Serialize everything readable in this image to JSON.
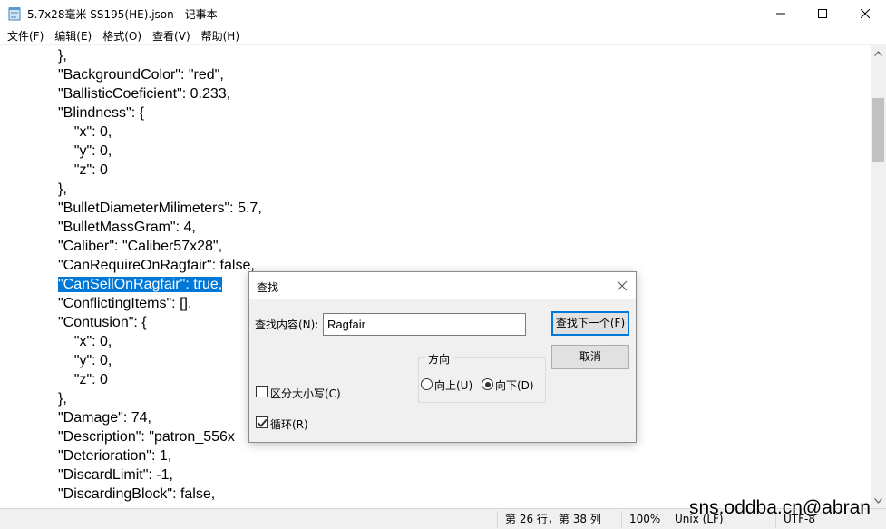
{
  "window": {
    "title": "5.7x28毫米 SS195(HE).json - 记事本",
    "icon": "notepad-icon"
  },
  "menu": {
    "items": [
      {
        "label": "文件(F)"
      },
      {
        "label": "编辑(E)"
      },
      {
        "label": "格式(O)"
      },
      {
        "label": "查看(V)"
      },
      {
        "label": "帮助(H)"
      }
    ]
  },
  "editor": {
    "lines": [
      "},",
      "\"BackgroundColor\": \"red\",",
      "\"BallisticCoeficient\": 0.233,",
      "\"Blindness\": {",
      "    \"x\": 0,",
      "    \"y\": 0,",
      "    \"z\": 0",
      "},",
      "\"BulletDiameterMilimeters\": 5.7,",
      "\"BulletMassGram\": 4,",
      "\"Caliber\": \"Caliber57x28\",",
      "\"CanRequireOnRagfair\": false,",
      "\"CanSellOnRagfair\": true,",
      "\"ConflictingItems\": [],",
      "\"Contusion\": {",
      "    \"x\": 0,",
      "    \"y\": 0,",
      "    \"z\": 0",
      "},",
      "\"Damage\": 74,",
      "\"Description\": \"patron_556x",
      "\"Deterioration\": 1,",
      "\"DiscardLimit\": -1,",
      "\"DiscardingBlock\": false,"
    ],
    "selected_line_index": 12
  },
  "find_dialog": {
    "title": "查找",
    "find_label": "查找内容(N):",
    "find_value": "Ragfair",
    "find_next_label": "查找下一个(F)",
    "cancel_label": "取消",
    "direction_label": "方向",
    "up_label": "向上(U)",
    "down_label": "向下(D)",
    "direction_selected": "down",
    "match_case_label": "区分大小写(C)",
    "match_case_checked": false,
    "wrap_label": "循环(R)",
    "wrap_checked": true
  },
  "statusbar": {
    "position": "第 26 行，第 38 列",
    "zoom": "100%",
    "line_ending": "Unix (LF)",
    "encoding": "UTF-8"
  },
  "watermark": "sns.oddba.cn@abran"
}
